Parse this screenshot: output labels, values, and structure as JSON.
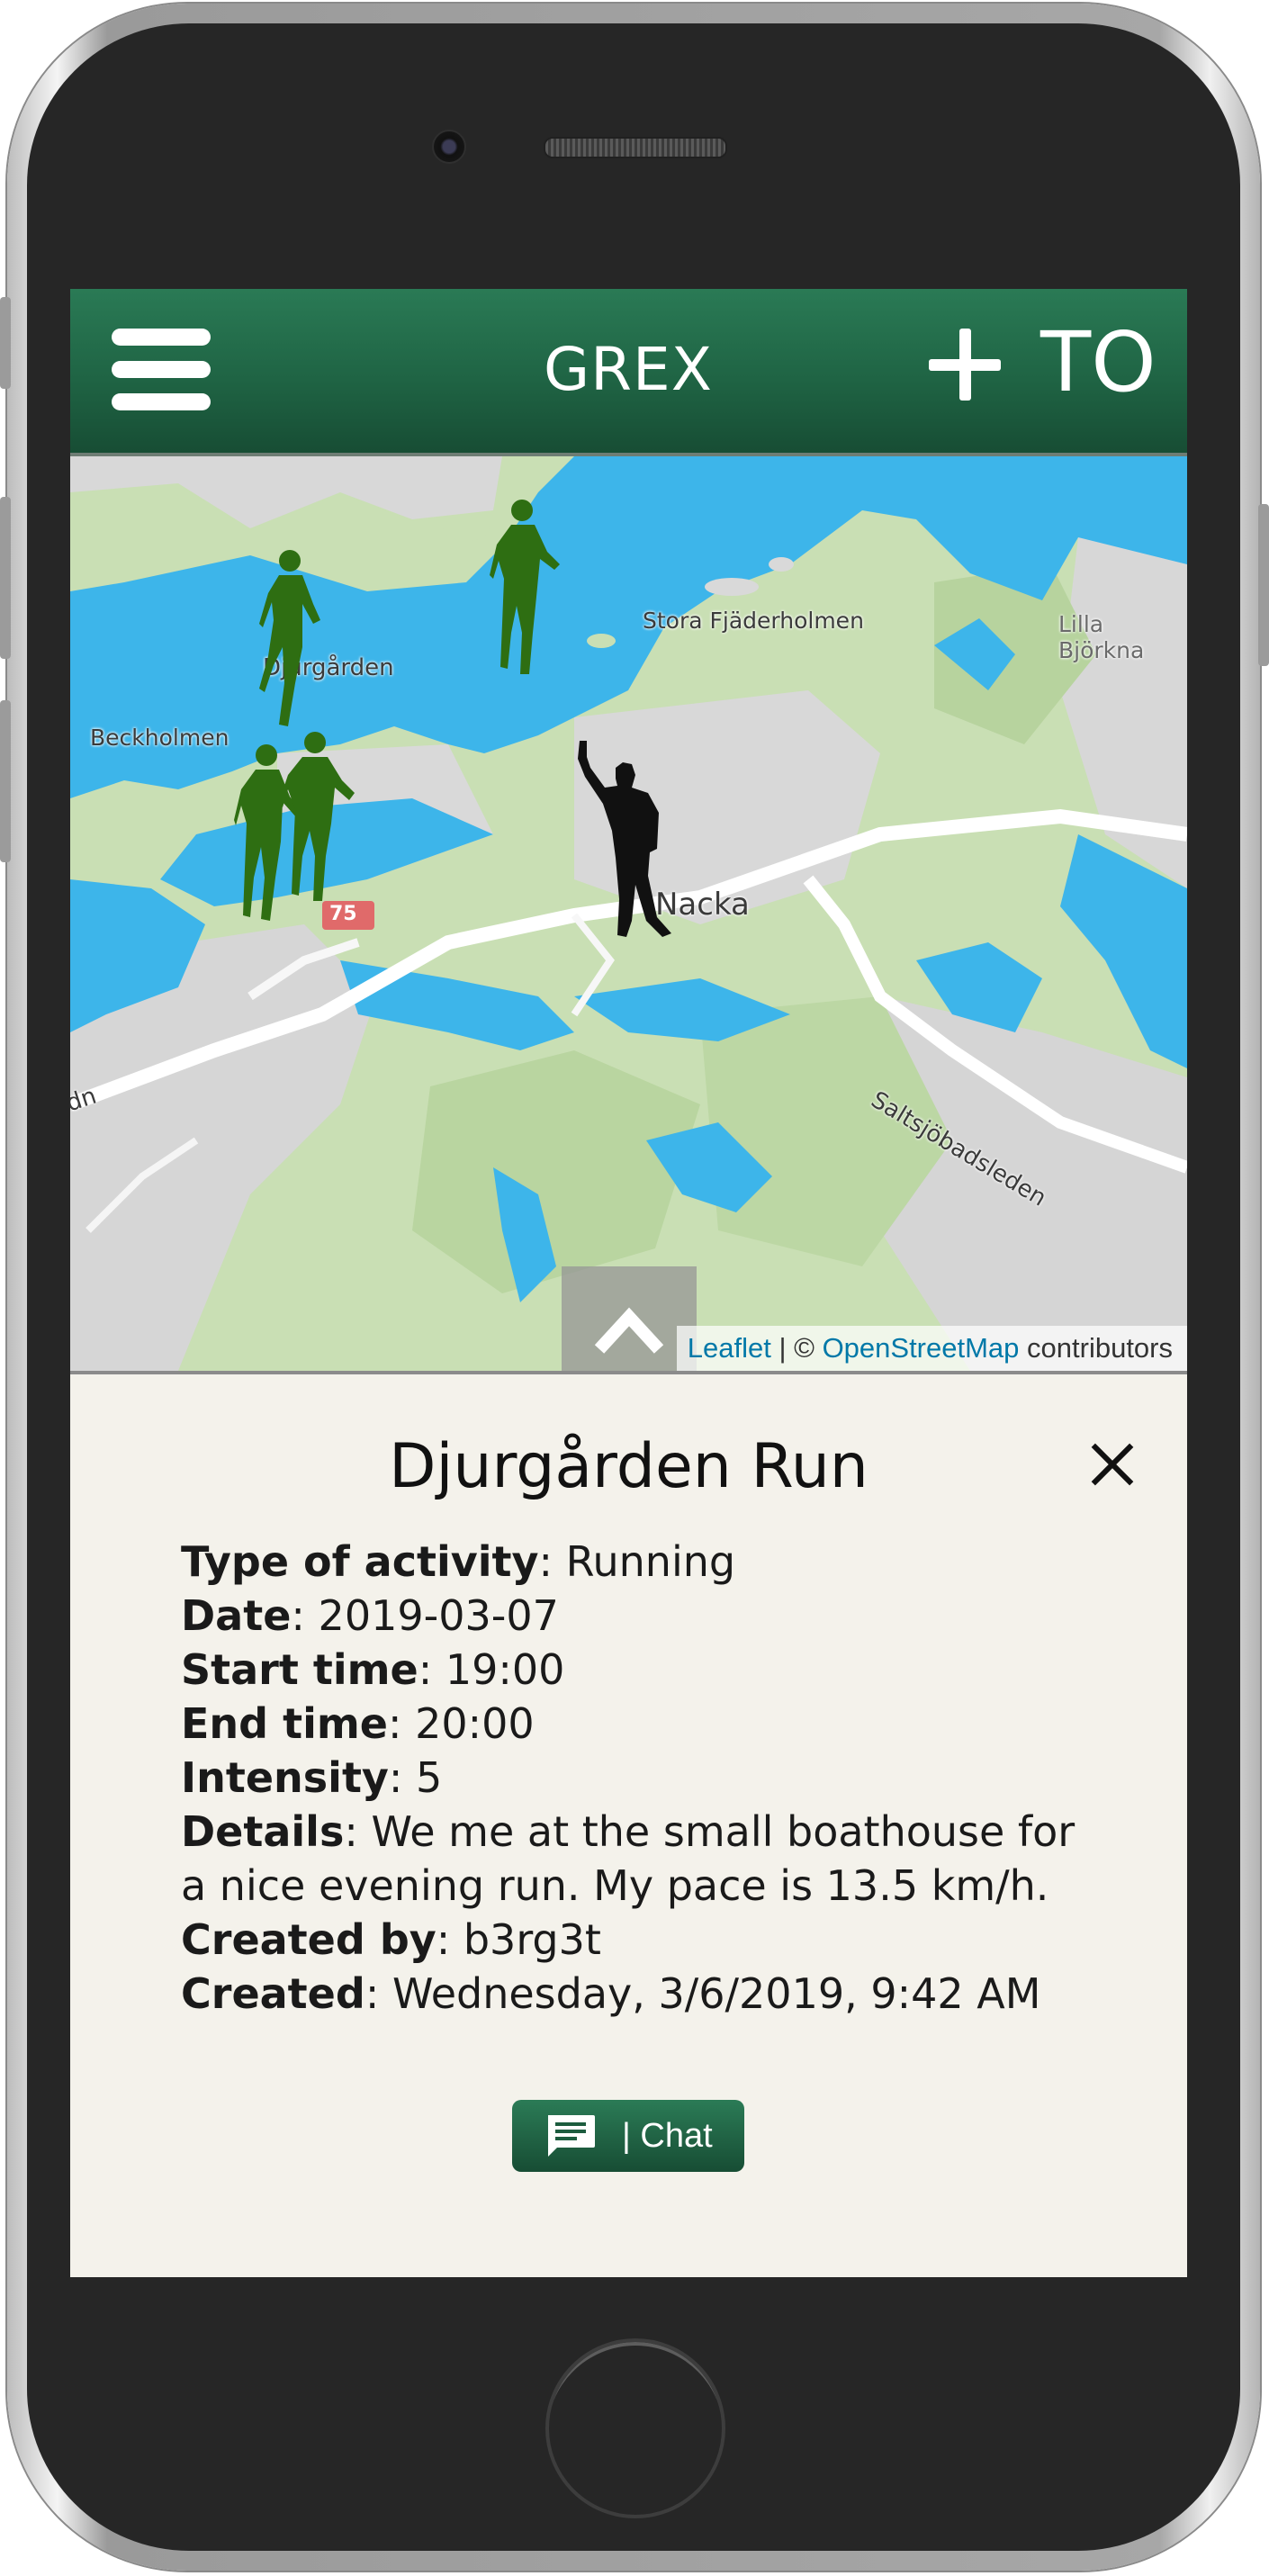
{
  "header": {
    "brand": "GREX",
    "add_label": "TO"
  },
  "map": {
    "labels": {
      "djurgarden": "Djurgården",
      "beckholmen": "Beckholmen",
      "stora": "Stora Fjäderholmen",
      "lilla": "Lilla Björkna",
      "nacka": "Nacka",
      "road": "Saltsjöbadsleden",
      "route_number": "75",
      "partial_left": "dn"
    },
    "attribution": {
      "leaflet": "Leaflet",
      "separator": " | © ",
      "osm": "OpenStreetMap",
      "suffix": " contributors"
    },
    "colors": {
      "water": "#3db5ea",
      "land": "#c9dfb4",
      "urban": "#d9d9d9",
      "runner": "#2e6e12",
      "user": "#111111"
    }
  },
  "activity": {
    "title": "Djurgården Run",
    "fields": [
      {
        "label": "Type of activity",
        "value": "Running"
      },
      {
        "label": "Date",
        "value": "2019-03-07"
      },
      {
        "label": "Start time",
        "value": "19:00"
      },
      {
        "label": "End time",
        "value": "20:00"
      },
      {
        "label": "Intensity",
        "value": "5"
      },
      {
        "label": "Details",
        "value": "We me at the small boathouse for a nice evening run. My pace is 13.5 km/h."
      },
      {
        "label": "Created by",
        "value": "b3rg3t"
      },
      {
        "label": "Created",
        "value": "Wednesday, 3/6/2019, 9:42 AM"
      }
    ],
    "chat_label": "| Chat"
  }
}
